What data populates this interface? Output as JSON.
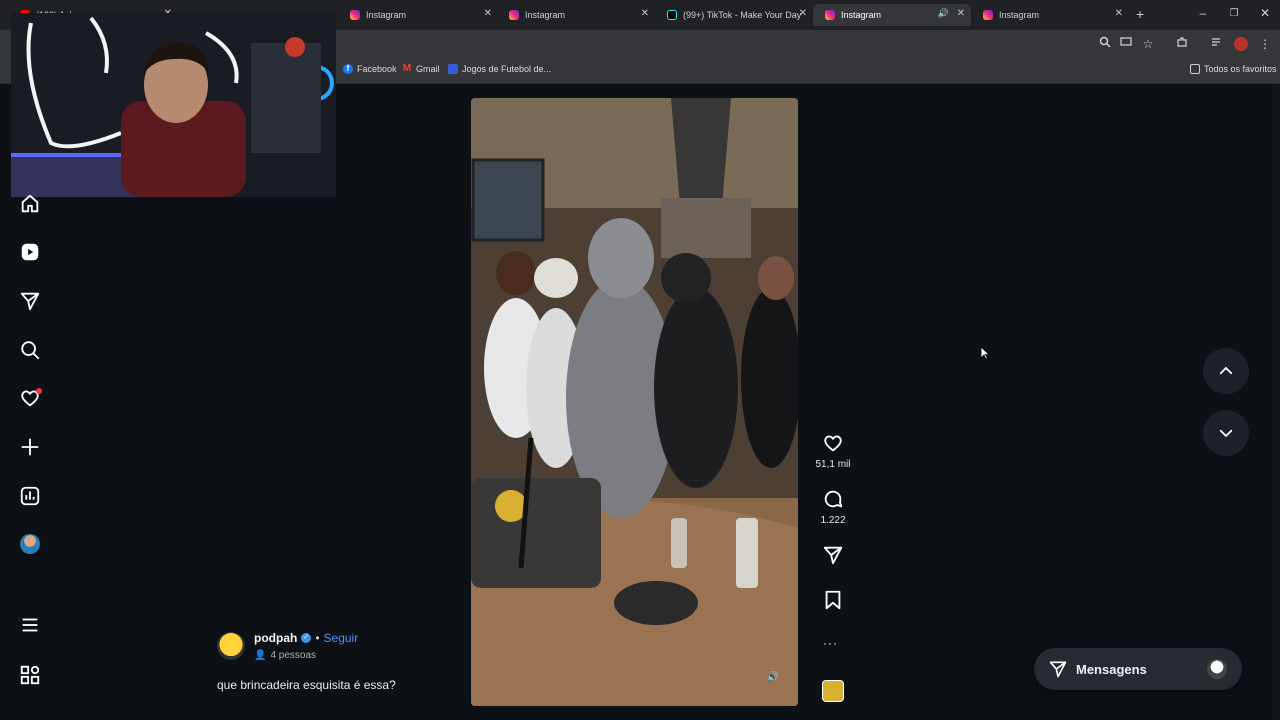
{
  "browser": {
    "tabs": [
      {
        "label": "(122) Ashura...",
        "partial": true
      },
      {
        "label": "Instagram"
      },
      {
        "label": "Instagram"
      },
      {
        "label": "(99+) TikTok - Make Your Day"
      },
      {
        "label": "Instagram",
        "active": true
      },
      {
        "label": "Instagram"
      }
    ],
    "bookmarks": [
      {
        "label": "Facebook",
        "icon": "facebook-icon"
      },
      {
        "label": "Gmail",
        "icon": "gmail-icon"
      },
      {
        "label": "Jogos de Futebol de...",
        "icon": "games-icon"
      }
    ],
    "all_bookmarks_label": "Todos os favoritos"
  },
  "post": {
    "username": "podpah",
    "follow_label": "Seguir",
    "separator": "•",
    "audience": "4 pessoas",
    "caption": "que brincadeira esquisita é essa?",
    "likes": "51,1 mil",
    "comments": "1.222",
    "more": "···"
  },
  "messages": {
    "label": "Mensagens"
  },
  "colors": {
    "follow": "#4a8fff",
    "verified": "#3897f0",
    "notify_dot": "#ff3040"
  }
}
